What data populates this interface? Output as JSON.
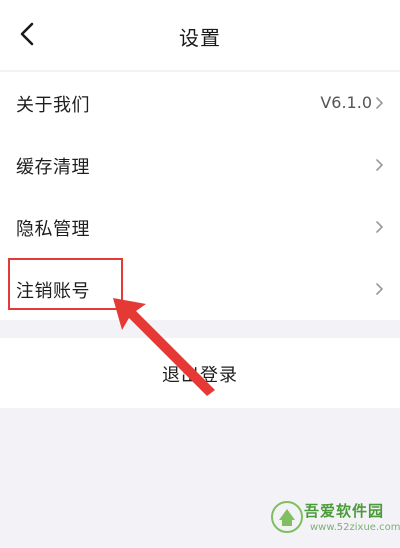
{
  "header": {
    "title": "设置",
    "back_icon": "chevron-left-icon"
  },
  "settings": {
    "items": [
      {
        "label": "关于我们",
        "value": "V6.1.0"
      },
      {
        "label": "缓存清理",
        "value": ""
      },
      {
        "label": "隐私管理",
        "value": ""
      },
      {
        "label": "注销账号",
        "value": ""
      }
    ]
  },
  "logout": {
    "label": "退出登录"
  },
  "annotation": {
    "color": "#e53935"
  },
  "watermark": {
    "site_name": "吾爱软件园",
    "url": "www.52zixue.com"
  }
}
